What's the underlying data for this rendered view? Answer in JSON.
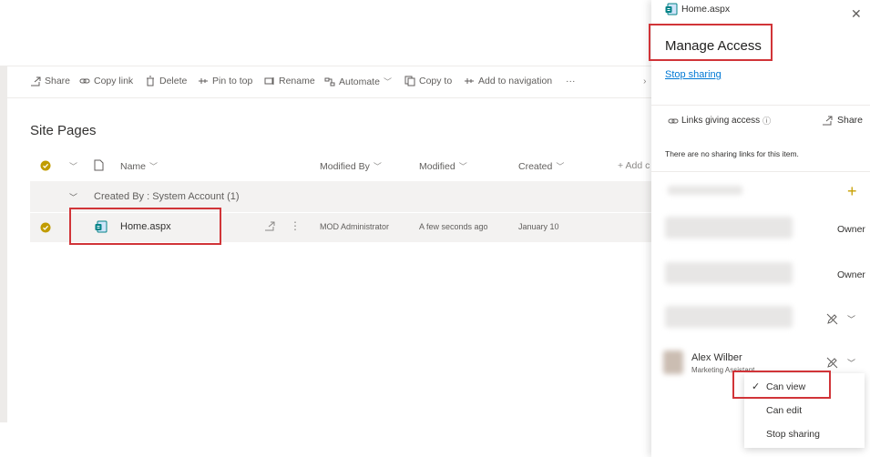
{
  "command_bar": {
    "share": "Share",
    "copy_link": "Copy link",
    "delete": "Delete",
    "pin_to_top": "Pin to top",
    "rename": "Rename",
    "automate": "Automate",
    "copy_to": "Copy to",
    "add_to_navigation": "Add to navigation",
    "more": "···"
  },
  "library": {
    "title": "Site Pages",
    "columns": {
      "name": "Name",
      "modified_by": "Modified By",
      "modified": "Modified",
      "created": "Created",
      "add_column": "+ Add c"
    },
    "group_label": "Created By : System Account (1)",
    "file": {
      "name": "Home.aspx",
      "modified_by": "MOD Administrator",
      "modified": "A few seconds ago",
      "created": "January 10"
    }
  },
  "panel": {
    "file_name": "Home.aspx",
    "title": "Manage Access",
    "stop_sharing": "Stop sharing",
    "links_header": "Links giving access",
    "share": "Share",
    "no_links": "There are no sharing links for this item.",
    "owner_1": "Owner",
    "owner_2": "Owner",
    "user_name": "Alex Wilber",
    "user_title": "Marketing Assistant"
  },
  "permission_menu": {
    "can_view": "Can view",
    "can_edit": "Can edit",
    "stop_sharing": "Stop sharing"
  },
  "colors": {
    "accent": "#0078d4",
    "highlight": "#d13438",
    "check": "#c19c00",
    "plus": "#c8a000"
  }
}
